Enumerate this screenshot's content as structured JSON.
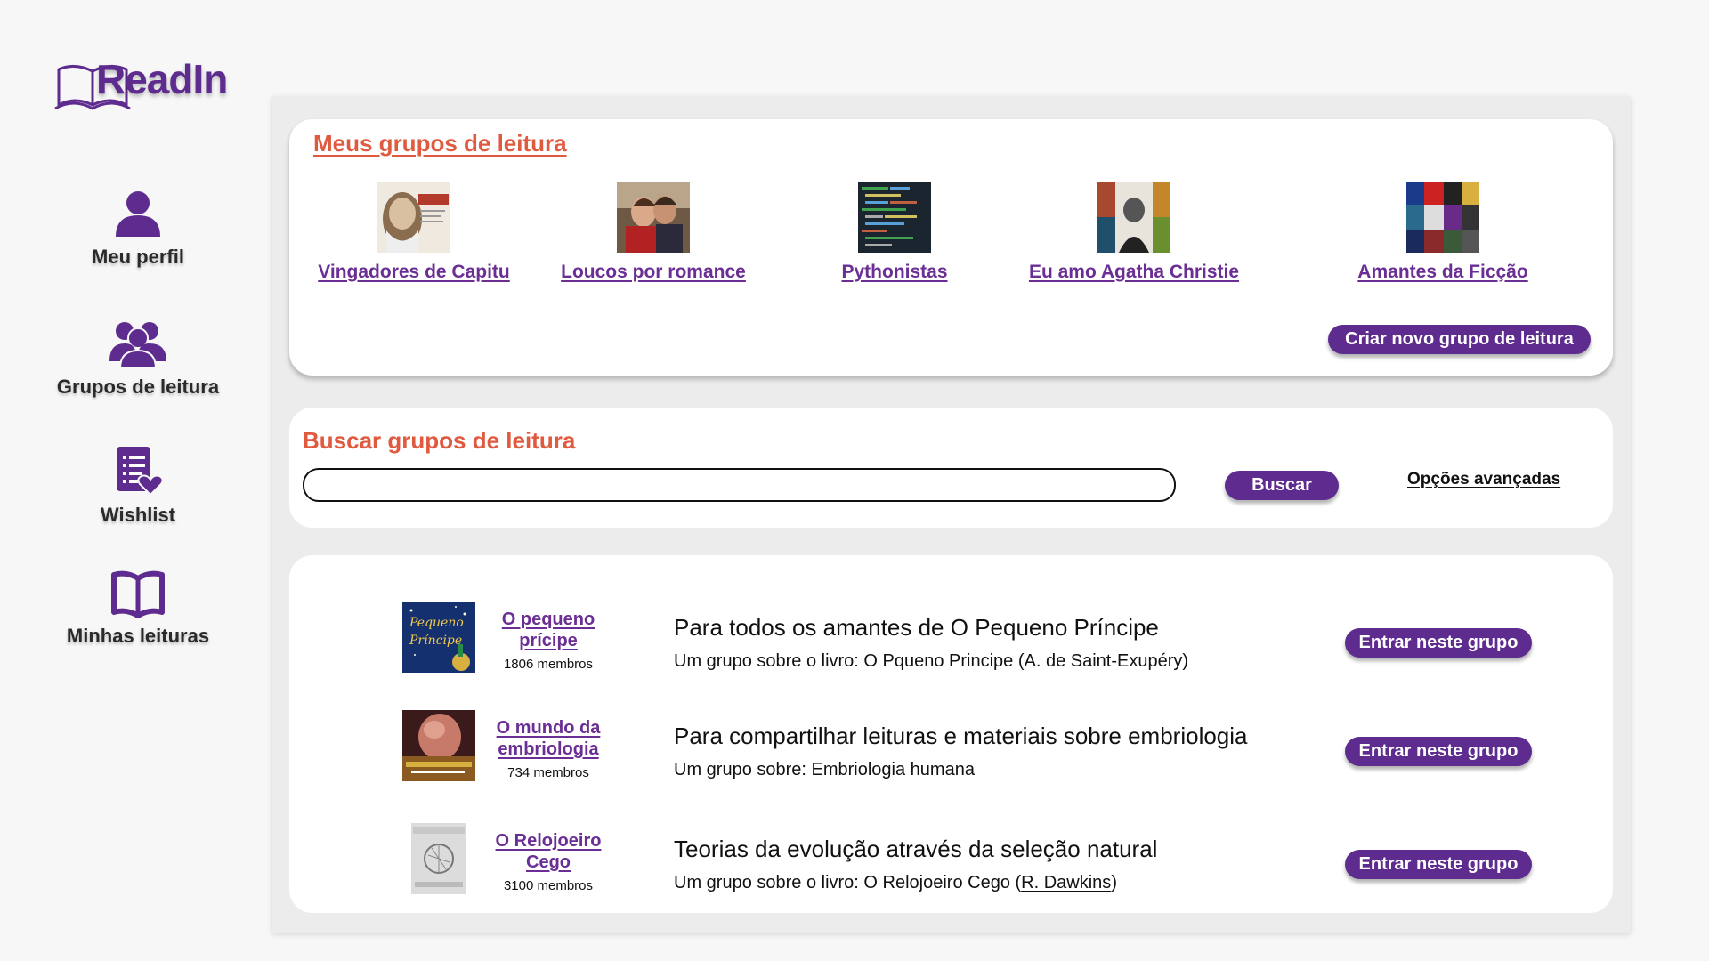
{
  "logo": {
    "text": "ReadIn"
  },
  "sidebar": {
    "items": [
      {
        "label": "Meu perfil",
        "icon": "user-icon"
      },
      {
        "label": "Grupos de leitura",
        "icon": "group-icon"
      },
      {
        "label": "Wishlist",
        "icon": "wishlist-icon"
      },
      {
        "label": "Minhas leituras",
        "icon": "open-book-icon"
      }
    ]
  },
  "my_groups": {
    "title": "Meus grupos de leitura",
    "items": [
      {
        "name": "Vingadores de Capitu"
      },
      {
        "name": "Loucos por romance"
      },
      {
        "name": "Pythonistas"
      },
      {
        "name": "Eu amo Agatha Christie"
      },
      {
        "name": "Amantes da Ficção"
      }
    ],
    "create_button": "Criar novo grupo de leitura"
  },
  "search": {
    "title": "Buscar grupos de leitura",
    "input_value": "",
    "button": "Buscar",
    "advanced": "Opções avançadas"
  },
  "results": [
    {
      "name_line1": "O pequeno",
      "name_line2": "prícipe",
      "members": "1806 membros",
      "title": "Para todos os amantes de O Pequeno Príncipe",
      "sub_prefix": "Um grupo sobre o livro:  O Pqueno Principe (A. de Saint-Exupéry)",
      "join": "Entrar neste grupo"
    },
    {
      "name_line1": "O mundo da",
      "name_line2": "embriologia",
      "members": "734 membros",
      "title": "Para compartilhar leituras e materiais sobre embriologia",
      "sub_prefix": "Um grupo sobre:  Embriologia humana",
      "join": "Entrar neste grupo"
    },
    {
      "name_line1": "O Relojoeiro",
      "name_line2": "Cego",
      "members": "3100 membros",
      "title": "Teorias da evolução através da seleção natural",
      "sub_prefix": "Um grupo sobre o livro:  O Relojoeiro Cego (",
      "sub_link": "R. Dawkins",
      "sub_suffix": ")",
      "join": "Entrar neste grupo"
    }
  ],
  "colors": {
    "brand": "#5e2b8f",
    "accent": "#e05a3f",
    "link": "#6a2e94"
  }
}
